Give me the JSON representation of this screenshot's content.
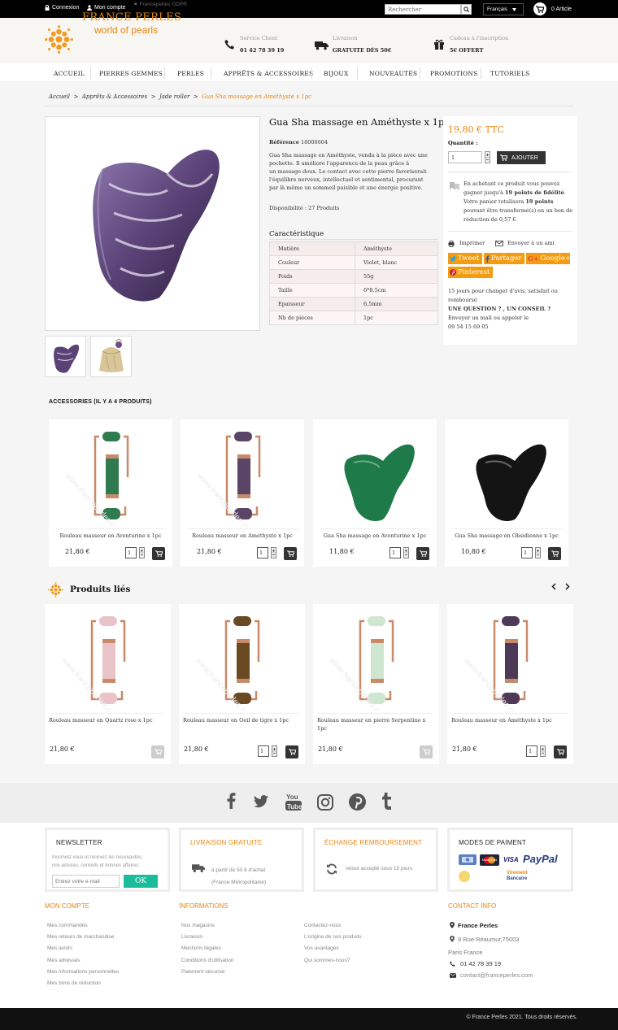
{
  "topbar": {
    "login": "Connexion",
    "account": "Mon compte",
    "gdpr": "Franceperles GDPR",
    "search_placeholder": "Rechercher",
    "language": "Français",
    "cart": "0 Article"
  },
  "header": {
    "logo_line1": "FRANCE PERLES",
    "logo_line2": "world of pearls",
    "service_label": "Service Client",
    "service_value": "01 42 78 39 19",
    "delivery_label": "Livraison",
    "delivery_value": "GRATUITE DÈS 50€",
    "gift_label": "Cadeau à l'inscription",
    "gift_value": "5€ OFFERT"
  },
  "nav": [
    "ACCUEIL",
    "PIERRES GEMMES",
    "PERLES",
    "APPRÊTS & ACCESSOIRES",
    "BIJOUX",
    "NOUVEAUTÉS",
    "PROMOTIONS",
    "TUTORIELS"
  ],
  "breadcrumb": {
    "items": [
      "Accueil",
      "Apprêts & Accessoires",
      "Jade roller"
    ],
    "separator": ">",
    "current": "Gua Sha massage en Améthyste x 1pc"
  },
  "product": {
    "title": "Gua Sha massage en Améthyste x 1pc",
    "reference_label": "Référence",
    "reference": "18000604",
    "description": [
      "Gua Sha massage en Améthyste, vendu à la pièce avec une",
      "pochette. Il améliore l'apparence de la peau grâce à",
      "un massage doux. Le contact avec cette pierre favoriserait",
      "l'équilibre nerveux, intellectuel et sentimental, procurant",
      "par là même un sommeil paisible et une énergie positive."
    ],
    "availability": "Disponibilité : 27 Produits",
    "features_title": "Caractéristique",
    "features": [
      [
        "Matière",
        "Améthyste"
      ],
      [
        "Couleur",
        "Violet, blanc"
      ],
      [
        "Poids",
        "55g"
      ],
      [
        "Taille",
        "6*8.5cm"
      ],
      [
        "Epaisseur",
        "6.5mm"
      ],
      [
        "Nb de pièces",
        "1pc"
      ]
    ]
  },
  "buybox": {
    "price": "19,80 € TTC",
    "qty_label": "Quantité :",
    "qty": "1",
    "add_label": "AJOUTER",
    "loyalty": [
      "En achetant ce produit vous pouvez",
      "gagner jusqu'à",
      "19 points de fidélité",
      "Votre panier totalisera",
      "19 points",
      "pouvant être transformé(s) en un bon",
      "de réduction de 0,57 €."
    ],
    "print": "Imprimer",
    "send": "Envoyer à un ami",
    "tweet": "Tweet",
    "share": "Partager",
    "google": "Google+",
    "pinterest": "Pinterest",
    "info_lines": [
      "15 jours pour changer d'avis, satisfait ou",
      "remboursé",
      "UNE QUESTION ? , UN CONSEIL ?",
      "Envoyer un mail ou appeler le",
      "09 54 15 69 05"
    ]
  },
  "accessories": {
    "title": "ACCESSORIES (IL Y A 4 PRODUITS)",
    "watermark": "www.franceperles.com",
    "items": [
      {
        "name": "Rouleau masseur en Aventurine x 1pc",
        "price": "21,80 €",
        "qty": "1",
        "kind": "roller",
        "color": "#2f7a4f"
      },
      {
        "name": "Rouleau masseur en Améthyste x 1pc",
        "price": "21,80 €",
        "qty": "1",
        "kind": "roller",
        "color": "#5b4566"
      },
      {
        "name": "Gua Sha massage en Aventurine x 1pc",
        "price": "11,80 €",
        "qty": "1",
        "kind": "guasha",
        "color": "#1f7a4a"
      },
      {
        "name": "Gua Sha massage en Obsidienne x 1pc",
        "price": "10,80 €",
        "qty": "1",
        "kind": "guasha",
        "color": "#141414"
      }
    ]
  },
  "related": {
    "title": "Produits liés",
    "watermark": "www.franceperles.com",
    "items": [
      {
        "name": "Rouleau masseur en Quartz rose x 1pc",
        "price": "21,80 €",
        "qty": "1",
        "color": "#e8c4c8",
        "in_stock": false
      },
      {
        "name": "Rouleau masseur en Oeil de tigre x 1pc",
        "price": "21,80 €",
        "qty": "1",
        "color": "#6a4a22",
        "in_stock": true
      },
      {
        "name": "Rouleau masseur en pierre Serpentine x 1pc",
        "price": "21,80 €",
        "qty": "1",
        "color": "#cfe6cf",
        "in_stock": false
      },
      {
        "name": "Rouleau masseur en Améthyste x 1pc",
        "price": "21,80 €",
        "qty": "1",
        "color": "#4e3a57",
        "in_stock": true
      }
    ]
  },
  "footer": {
    "newsletter_title": "NEWSLETTER",
    "newsletter_text": [
      "Inscrivez-vous et recevez les nouveautés,",
      "nos astuces, conseils et bonnes affaires"
    ],
    "newsletter_placeholder": "Entrez votre e-mail",
    "newsletter_button": "OK",
    "delivery_title": "LIVRAISON GRATUITE",
    "delivery_text": [
      "à partir de 50 € d'achat",
      "(France Métropolitaine)"
    ],
    "exchange_title": "ÉCHANGE REMBOURSEMENT",
    "exchange_text": "retour accepté sous 15 jours",
    "payment_title": "MODES DE PAIMENT",
    "payment_paypal": "PayPal",
    "payment_visa": "VISA",
    "payment_mastercard": "MasterCard",
    "payment_virement": "Virement",
    "payment_bancaire": "Bancaire",
    "account_title": "MON COMPTE",
    "account_links": [
      "Mes commandes",
      "Mes retours de marchandise",
      "Mes avoirs",
      "Mes adresses",
      "Mes informations personnelles",
      "Mes bons de réduction"
    ],
    "info_title": "INFORMATIONS",
    "info_links_1": [
      "Nos magasins",
      "Livraison",
      "Mentions légales",
      "Conditions d'utilisation",
      "Paiement sécurisé"
    ],
    "info_links_2": [
      "Contactez-nous",
      "L'origine de nos produits",
      "Vos avantages",
      "Qui sommes-nous?"
    ],
    "contact_title": "CONTACT INFO",
    "contact_name": "France Perles",
    "contact_address": "9 Rue Réaumur,75003",
    "contact_city": "Paris France",
    "contact_phone": "01 42 78 39 19",
    "contact_email": "contact@franceperles.com",
    "copyright": "© France Perles 2021. Tous droits réservés."
  },
  "colors": {
    "accent": "#e8860f",
    "share": "#f39c12",
    "ok_button": "#1abc9c",
    "dark": "#333333"
  }
}
